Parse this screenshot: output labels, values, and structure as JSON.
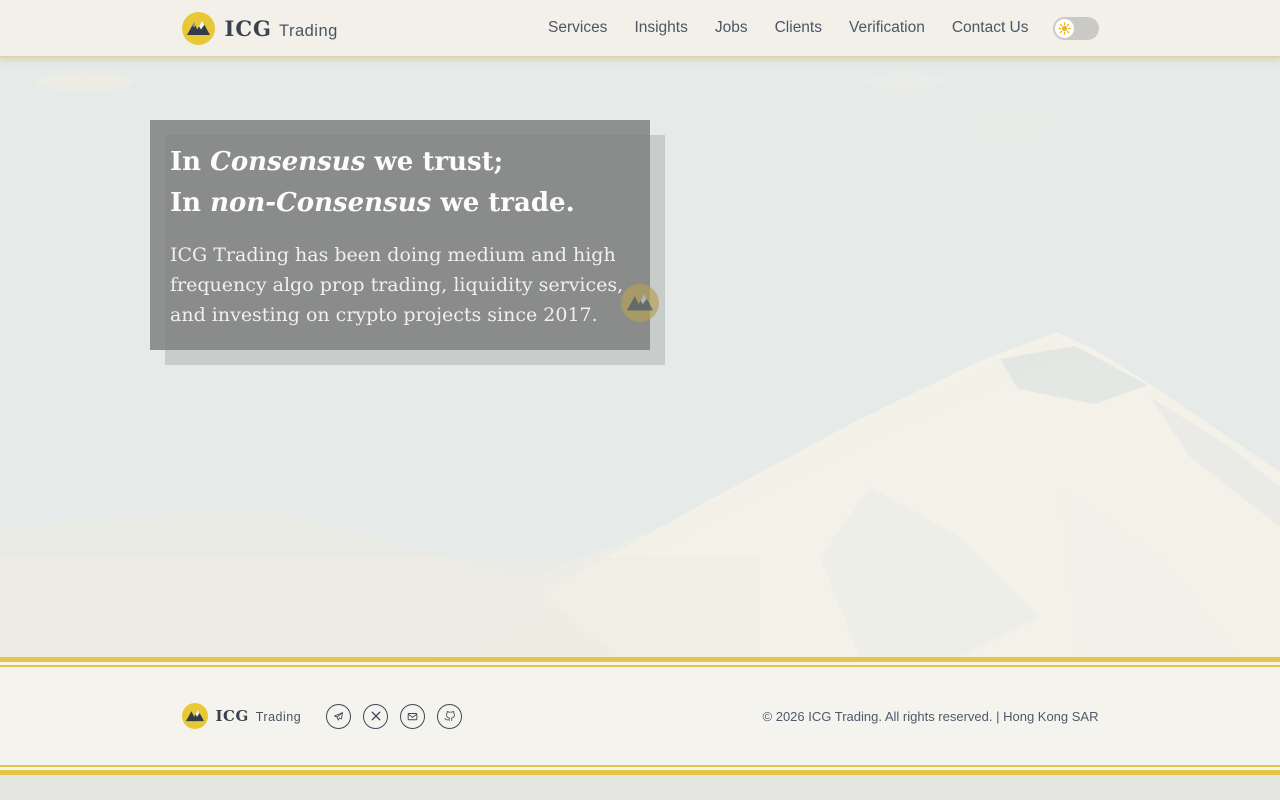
{
  "brand": {
    "name_primary": "ICG",
    "name_secondary": "Trading"
  },
  "header": {
    "nav": [
      {
        "label": "Services"
      },
      {
        "label": "Insights"
      },
      {
        "label": "Jobs"
      },
      {
        "label": "Clients"
      },
      {
        "label": "Verification"
      },
      {
        "label": "Contact Us"
      }
    ],
    "theme_toggle": {
      "state": "light",
      "icon": "sun-icon"
    }
  },
  "hero": {
    "heading_line1": {
      "prefix": "In ",
      "emphasis": "Consensus",
      "suffix": " we trust;"
    },
    "heading_line2": {
      "prefix": "In ",
      "emphasis": "non-Consensus",
      "suffix": " we trade."
    },
    "description": "ICG Trading has been doing medium and high frequency algo prop trading, liquidity services, and investing on crypto projects since 2017."
  },
  "footer": {
    "social": [
      {
        "name": "telegram"
      },
      {
        "name": "x-twitter"
      },
      {
        "name": "email"
      },
      {
        "name": "github"
      }
    ],
    "copyright": "© 2026 ICG Trading. All rights reserved. | Hong Kong SAR"
  },
  "colors": {
    "accent_gold": "#e3c645",
    "brand_yellow": "#e9c838",
    "header_bg": "#f2f0e9",
    "footer_bg": "#f5f3ee",
    "hero_sky": "#e6eae9",
    "hero_mountain": "#f4f1e8",
    "hero_box": "#9fa2a0",
    "nav_text": "#4d5665"
  }
}
